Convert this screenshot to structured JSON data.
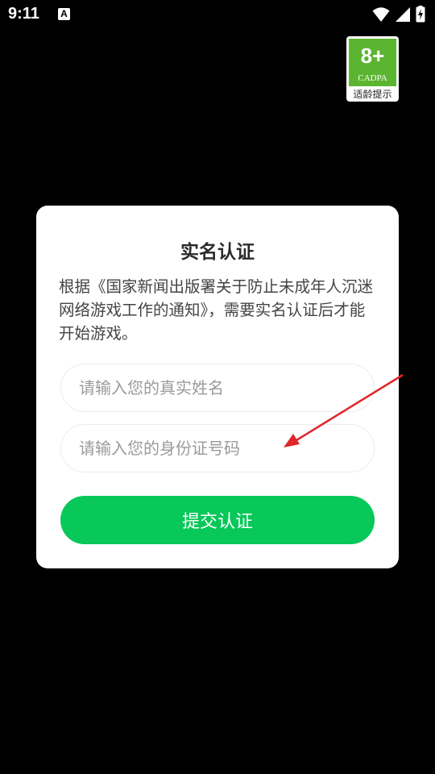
{
  "status_bar": {
    "time": "9:11",
    "notification_icon": "A",
    "icons": [
      "wifi-icon",
      "cell-signal-icon",
      "battery-charging-icon"
    ]
  },
  "age_badge": {
    "rating": "8+",
    "org": "CADPA",
    "hint": "适龄提示",
    "color": "#5cb531"
  },
  "dialog": {
    "title": "实名认证",
    "description": "根据《国家新闻出版署关于防止未成年人沉迷网络游戏工作的通知》，需要实名认证后才能开始游戏。",
    "name_input": {
      "placeholder": "请输入您的真实姓名",
      "value": ""
    },
    "id_input": {
      "placeholder": "请输入您的身份证号码",
      "value": ""
    },
    "submit_label": "提交认证",
    "accent_color": "#07c858"
  },
  "annotation": {
    "arrow_color": "#e0262a"
  }
}
